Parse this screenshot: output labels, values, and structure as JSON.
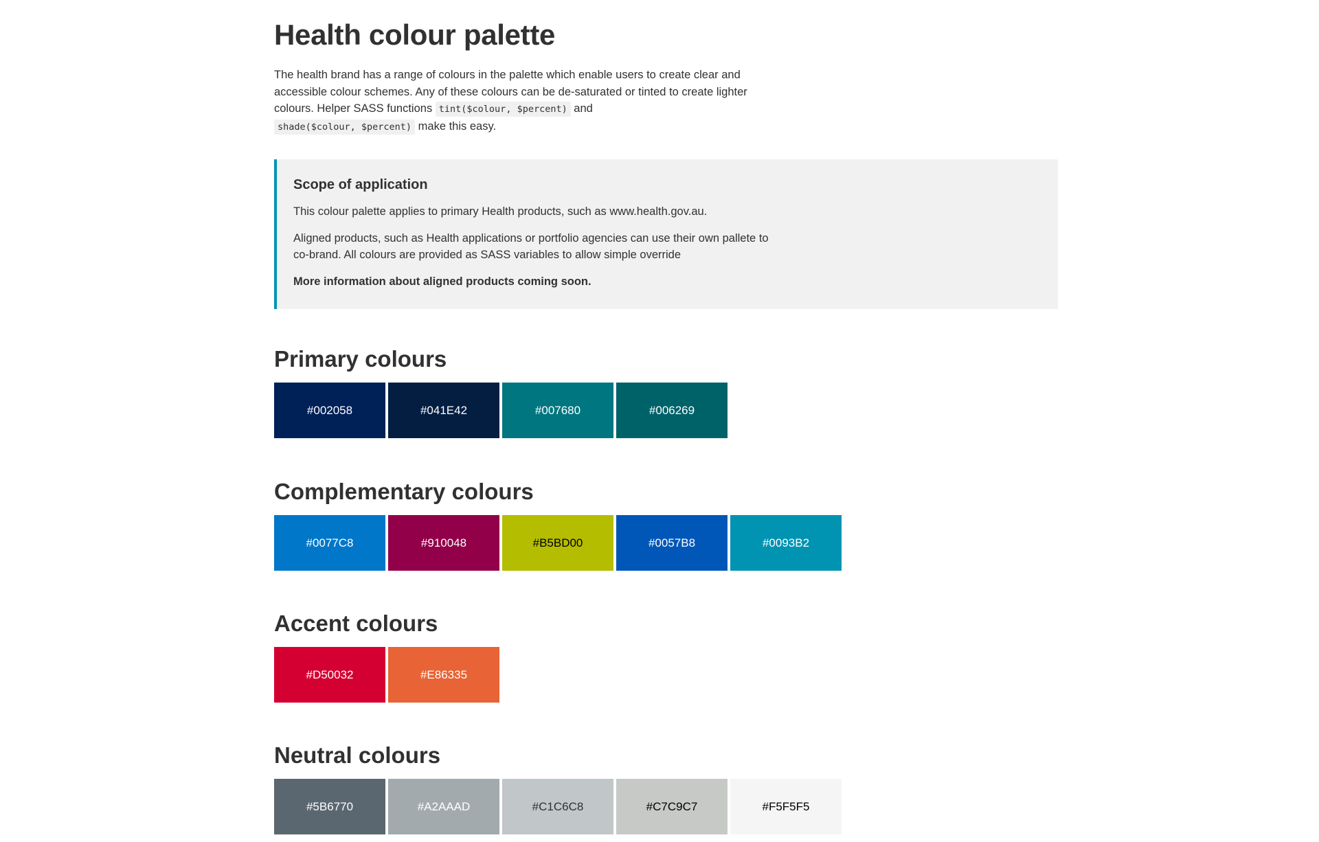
{
  "page": {
    "title": "Health colour palette",
    "intro": {
      "part1": "The health brand has a range of colours in the palette which enable users to create clear and accessible colour schemes. Any of these colours can be de-saturated or tinted to create lighter colours. Helper SASS functions ",
      "code1": "tint($colour, $percent)",
      "part2": " and ",
      "code2": "shade($colour, $percent)",
      "part3": " make this easy."
    }
  },
  "callout": {
    "heading": "Scope of application",
    "para1": "This colour palette applies to primary Health products, such as www.health.gov.au.",
    "para2": "Aligned products, such as Health applications or portfolio agencies can use their own pallete to co-brand. All colours are provided as SASS variables to allow simple override",
    "para3": "More information about aligned products coming soon.",
    "accent_color": "#0093B2"
  },
  "sections": {
    "primary": {
      "heading": "Primary colours",
      "swatches": [
        {
          "label": "#002058",
          "color": "#002058",
          "text_color": "#ffffff"
        },
        {
          "label": "#041E42",
          "color": "#041E42",
          "text_color": "#ffffff"
        },
        {
          "label": "#007680",
          "color": "#007680",
          "text_color": "#ffffff"
        },
        {
          "label": "#006269",
          "color": "#006269",
          "text_color": "#ffffff"
        }
      ]
    },
    "complementary": {
      "heading": "Complementary colours",
      "swatches": [
        {
          "label": "#0077C8",
          "color": "#0077C8",
          "text_color": "#ffffff"
        },
        {
          "label": "#910048",
          "color": "#910048",
          "text_color": "#ffffff"
        },
        {
          "label": "#B5BD00",
          "color": "#B5BD00",
          "text_color": "#000000"
        },
        {
          "label": "#0057B8",
          "color": "#0057B8",
          "text_color": "#ffffff"
        },
        {
          "label": "#0093B2",
          "color": "#0093B2",
          "text_color": "#ffffff"
        }
      ]
    },
    "accent": {
      "heading": "Accent colours",
      "swatches": [
        {
          "label": "#D50032",
          "color": "#D50032",
          "text_color": "#ffffff"
        },
        {
          "label": "#E86335",
          "color": "#E86335",
          "text_color": "#ffffff"
        }
      ]
    },
    "neutral": {
      "heading": "Neutral colours",
      "swatches": [
        {
          "label": "#5B6770",
          "color": "#5B6770",
          "text_color": "#ffffff"
        },
        {
          "label": "#A2AAAD",
          "color": "#A2AAAD",
          "text_color": "#ffffff"
        },
        {
          "label": "#C1C6C8",
          "color": "#C1C6C8",
          "text_color": "#313131"
        },
        {
          "label": "#C7C9C7",
          "color": "#C7C9C7",
          "text_color": "#000000"
        },
        {
          "label": "#F5F5F5",
          "color": "#F5F5F5",
          "text_color": "#000000"
        }
      ]
    }
  }
}
